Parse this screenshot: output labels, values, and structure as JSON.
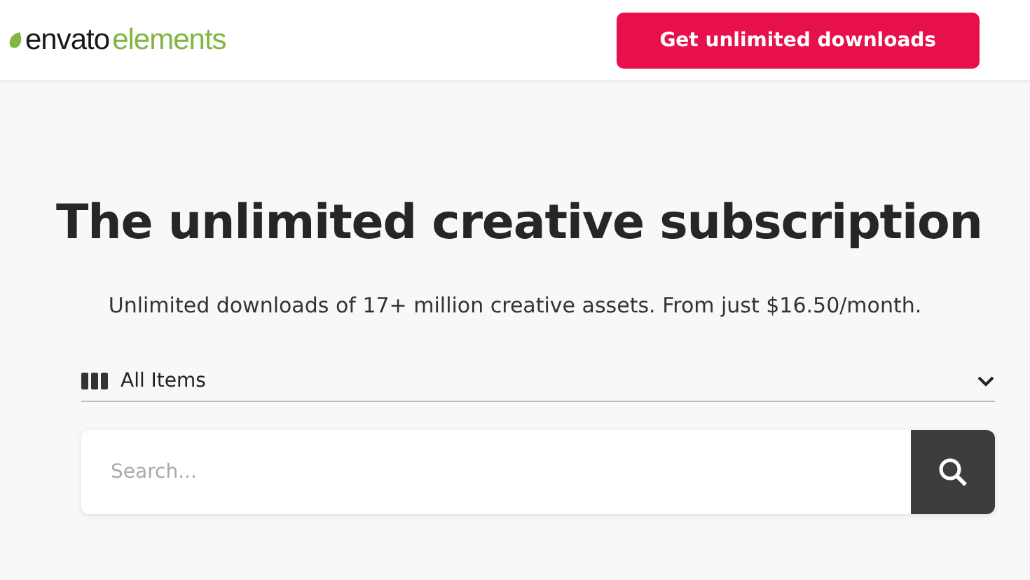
{
  "header": {
    "logo": {
      "part_1": "envato",
      "part_2": "elements"
    },
    "cta_button": "Get unlimited downloads"
  },
  "hero": {
    "title": "The unlimited creative subscription",
    "subtitle": "Unlimited downloads of 17+ million creative assets. From just $16.50/month."
  },
  "category_select": {
    "value": "All Items"
  },
  "search": {
    "placeholder": "Search..."
  }
}
